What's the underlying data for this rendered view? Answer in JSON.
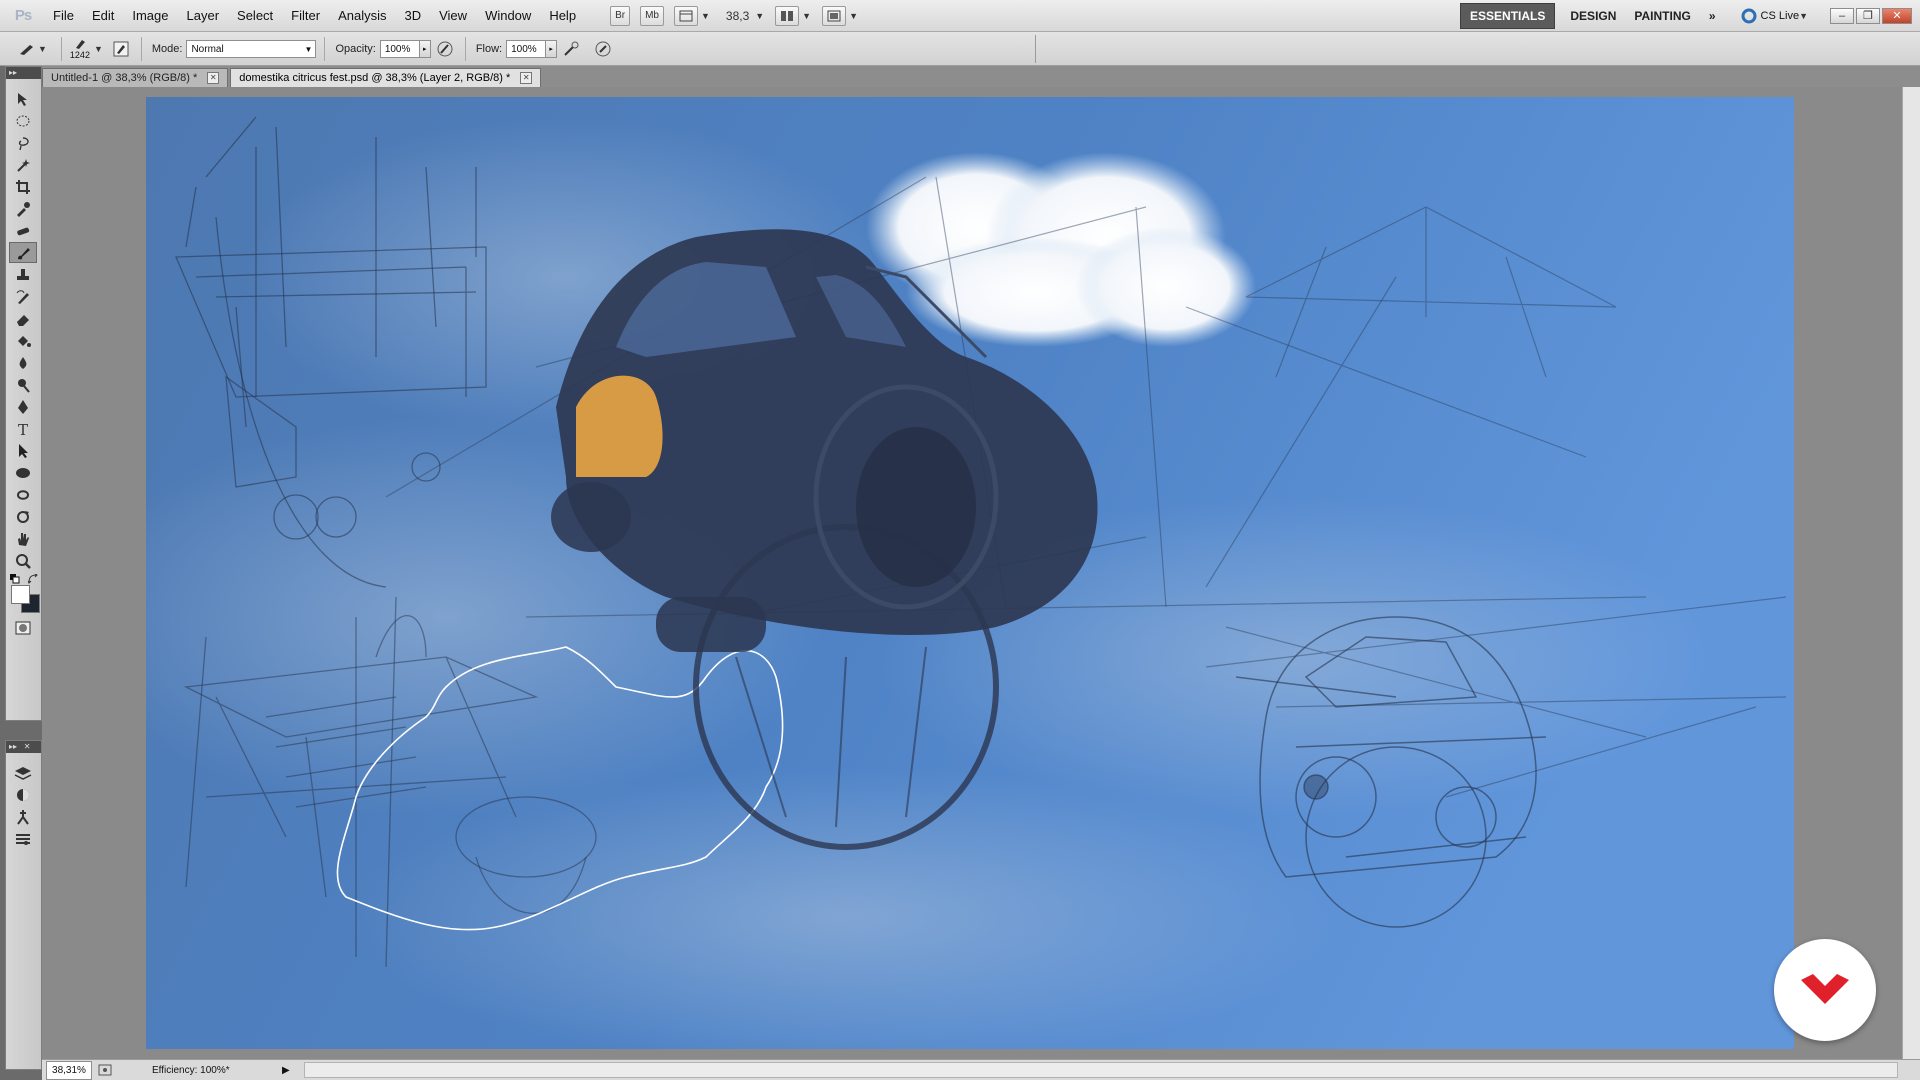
{
  "app": {
    "logo": "Ps",
    "menus": [
      "File",
      "Edit",
      "Image",
      "Layer",
      "Select",
      "Filter",
      "Analysis",
      "3D",
      "View",
      "Window",
      "Help"
    ],
    "bridge_btn": "Br",
    "minibridge_btn": "Mb",
    "zoom_level": "38,3",
    "workspaces": [
      "ESSENTIALS",
      "DESIGN",
      "PAINTING"
    ],
    "cs_live": "CS Live",
    "more_icon": "double-chevron-icon"
  },
  "options": {
    "brush_size": "1242",
    "mode_label": "Mode:",
    "mode_value": "Normal",
    "opacity_label": "Opacity:",
    "opacity_value": "100%",
    "flow_label": "Flow:",
    "flow_value": "100%"
  },
  "tabs": [
    {
      "label": "Untitled-1 @ 38,3% (RGB/8) *",
      "active": false
    },
    {
      "label": "domestika citricus fest.psd @ 38,3% (Layer 2, RGB/8) *",
      "active": true
    }
  ],
  "tools": [
    "move-tool",
    "marquee-tool",
    "lasso-tool",
    "quick-selection-tool",
    "crop-tool",
    "eyedropper-tool",
    "healing-brush-tool",
    "brush-tool",
    "clone-stamp-tool",
    "history-brush-tool",
    "eraser-tool",
    "paint-bucket-tool",
    "blur-tool",
    "dodge-tool",
    "pen-tool",
    "type-tool",
    "path-selection-tool",
    "shape-tool",
    "3d-rotate-tool",
    "3d-orbit-tool",
    "hand-tool",
    "zoom-tool"
  ],
  "status": {
    "zoom": "38,31%",
    "efficiency": "Efficiency: 100%*"
  },
  "colors": {
    "canvas_sky": "#4d7fbd",
    "canvas_sky_light": "#6a9ad8",
    "car_dark": "#2c3650",
    "fender_orange": "#d79a45",
    "brand_red": "#e0212b"
  }
}
